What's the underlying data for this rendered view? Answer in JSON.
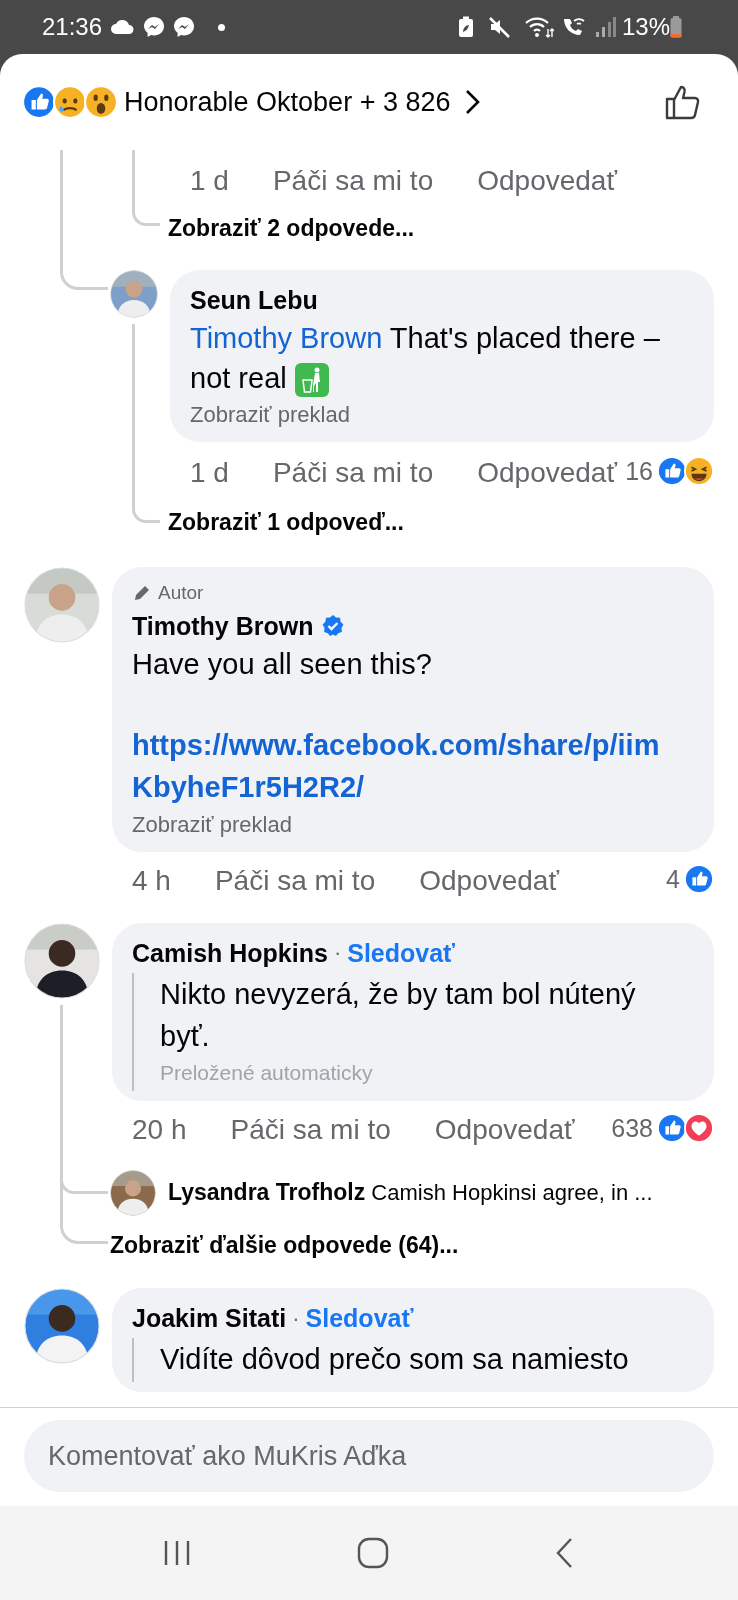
{
  "status_bar": {
    "time": "21:36",
    "battery": "13%"
  },
  "header": {
    "reactions": [
      {
        "kind": "like"
      },
      {
        "kind": "sad"
      },
      {
        "kind": "wow"
      }
    ],
    "title": "Honorable Oktober + 3 826"
  },
  "first_thread": {
    "partial_reply": {
      "time": "1 d",
      "like": "Páči sa mi to",
      "reply": "Odpovedať",
      "view_replies": "Zobraziť 2 odpovede..."
    },
    "reply": {
      "kind": "original",
      "author": "Seun Lebu",
      "verified": false,
      "mention": "Timothy Brown",
      "text": "That's placed there – not real",
      "trailing_icon": true,
      "translate": "Zobraziť preklad",
      "time": "1 d",
      "like": "Páči sa mi to",
      "reply": "Odpovedať",
      "reaction_count": "16",
      "reactions": [
        {
          "kind": "like"
        },
        {
          "kind": "haha"
        }
      ],
      "view_replies": "Zobraziť 1 odpoveď..."
    }
  },
  "comments": [
    {
      "kind": "original",
      "role": "Autor",
      "author": "Timothy Brown",
      "verified": true,
      "text": "Have you all seen this?",
      "link": "https://www.facebook.com/share/p/iimKbyheF1r5H2R2/",
      "translate": "Zobraziť preklad",
      "time": "4 h",
      "like": "Páči sa mi to",
      "reply": "Odpovedať",
      "reaction_count": "4",
      "reactions": [
        {
          "kind": "like"
        }
      ]
    },
    {
      "kind": "translated",
      "author": "Camish Hopkins",
      "verified": false,
      "separator": "·",
      "follow": "Sledovať",
      "text": "Nikto nevyzerá, že by tam bol nútený byť.",
      "translated_note": "Preložené automaticky",
      "time": "20 h",
      "like": "Páči sa mi to",
      "reply": "Odpovedať",
      "reaction_count": "638",
      "reactions": [
        {
          "kind": "like"
        },
        {
          "kind": "love"
        }
      ],
      "replies": [
        {
          "author": "Lysandra Trofholz",
          "text": "Camish Hopkinsi agree, in ..."
        }
      ],
      "view_more": "Zobraziť ďalšie odpovede (64)..."
    },
    {
      "kind": "translated",
      "author": "Joakim Sitati",
      "verified": false,
      "separator": "·",
      "follow": "Sledovať",
      "text": "Vidíte dôvod prečo som sa namiesto"
    }
  ],
  "composer": {
    "placeholder": "Komentovať ako MuKris Aďka"
  }
}
